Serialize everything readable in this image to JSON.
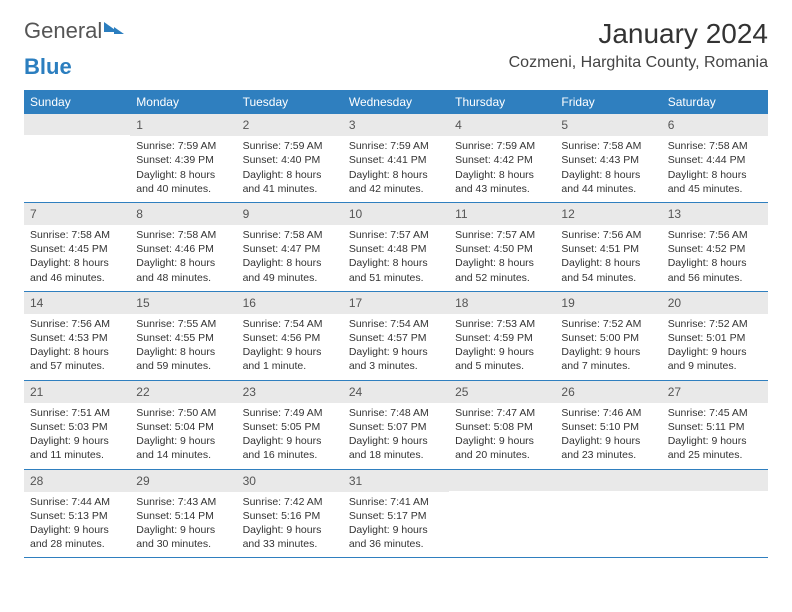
{
  "brand": {
    "part1": "General",
    "part2": "Blue"
  },
  "title": "January 2024",
  "location": "Cozmeni, Harghita County, Romania",
  "weekdays": [
    "Sunday",
    "Monday",
    "Tuesday",
    "Wednesday",
    "Thursday",
    "Friday",
    "Saturday"
  ],
  "weeks": [
    [
      {
        "n": "",
        "sunrise": "",
        "sunset": "",
        "daylight": ""
      },
      {
        "n": "1",
        "sunrise": "Sunrise: 7:59 AM",
        "sunset": "Sunset: 4:39 PM",
        "daylight": "Daylight: 8 hours and 40 minutes."
      },
      {
        "n": "2",
        "sunrise": "Sunrise: 7:59 AM",
        "sunset": "Sunset: 4:40 PM",
        "daylight": "Daylight: 8 hours and 41 minutes."
      },
      {
        "n": "3",
        "sunrise": "Sunrise: 7:59 AM",
        "sunset": "Sunset: 4:41 PM",
        "daylight": "Daylight: 8 hours and 42 minutes."
      },
      {
        "n": "4",
        "sunrise": "Sunrise: 7:59 AM",
        "sunset": "Sunset: 4:42 PM",
        "daylight": "Daylight: 8 hours and 43 minutes."
      },
      {
        "n": "5",
        "sunrise": "Sunrise: 7:58 AM",
        "sunset": "Sunset: 4:43 PM",
        "daylight": "Daylight: 8 hours and 44 minutes."
      },
      {
        "n": "6",
        "sunrise": "Sunrise: 7:58 AM",
        "sunset": "Sunset: 4:44 PM",
        "daylight": "Daylight: 8 hours and 45 minutes."
      }
    ],
    [
      {
        "n": "7",
        "sunrise": "Sunrise: 7:58 AM",
        "sunset": "Sunset: 4:45 PM",
        "daylight": "Daylight: 8 hours and 46 minutes."
      },
      {
        "n": "8",
        "sunrise": "Sunrise: 7:58 AM",
        "sunset": "Sunset: 4:46 PM",
        "daylight": "Daylight: 8 hours and 48 minutes."
      },
      {
        "n": "9",
        "sunrise": "Sunrise: 7:58 AM",
        "sunset": "Sunset: 4:47 PM",
        "daylight": "Daylight: 8 hours and 49 minutes."
      },
      {
        "n": "10",
        "sunrise": "Sunrise: 7:57 AM",
        "sunset": "Sunset: 4:48 PM",
        "daylight": "Daylight: 8 hours and 51 minutes."
      },
      {
        "n": "11",
        "sunrise": "Sunrise: 7:57 AM",
        "sunset": "Sunset: 4:50 PM",
        "daylight": "Daylight: 8 hours and 52 minutes."
      },
      {
        "n": "12",
        "sunrise": "Sunrise: 7:56 AM",
        "sunset": "Sunset: 4:51 PM",
        "daylight": "Daylight: 8 hours and 54 minutes."
      },
      {
        "n": "13",
        "sunrise": "Sunrise: 7:56 AM",
        "sunset": "Sunset: 4:52 PM",
        "daylight": "Daylight: 8 hours and 56 minutes."
      }
    ],
    [
      {
        "n": "14",
        "sunrise": "Sunrise: 7:56 AM",
        "sunset": "Sunset: 4:53 PM",
        "daylight": "Daylight: 8 hours and 57 minutes."
      },
      {
        "n": "15",
        "sunrise": "Sunrise: 7:55 AM",
        "sunset": "Sunset: 4:55 PM",
        "daylight": "Daylight: 8 hours and 59 minutes."
      },
      {
        "n": "16",
        "sunrise": "Sunrise: 7:54 AM",
        "sunset": "Sunset: 4:56 PM",
        "daylight": "Daylight: 9 hours and 1 minute."
      },
      {
        "n": "17",
        "sunrise": "Sunrise: 7:54 AM",
        "sunset": "Sunset: 4:57 PM",
        "daylight": "Daylight: 9 hours and 3 minutes."
      },
      {
        "n": "18",
        "sunrise": "Sunrise: 7:53 AM",
        "sunset": "Sunset: 4:59 PM",
        "daylight": "Daylight: 9 hours and 5 minutes."
      },
      {
        "n": "19",
        "sunrise": "Sunrise: 7:52 AM",
        "sunset": "Sunset: 5:00 PM",
        "daylight": "Daylight: 9 hours and 7 minutes."
      },
      {
        "n": "20",
        "sunrise": "Sunrise: 7:52 AM",
        "sunset": "Sunset: 5:01 PM",
        "daylight": "Daylight: 9 hours and 9 minutes."
      }
    ],
    [
      {
        "n": "21",
        "sunrise": "Sunrise: 7:51 AM",
        "sunset": "Sunset: 5:03 PM",
        "daylight": "Daylight: 9 hours and 11 minutes."
      },
      {
        "n": "22",
        "sunrise": "Sunrise: 7:50 AM",
        "sunset": "Sunset: 5:04 PM",
        "daylight": "Daylight: 9 hours and 14 minutes."
      },
      {
        "n": "23",
        "sunrise": "Sunrise: 7:49 AM",
        "sunset": "Sunset: 5:05 PM",
        "daylight": "Daylight: 9 hours and 16 minutes."
      },
      {
        "n": "24",
        "sunrise": "Sunrise: 7:48 AM",
        "sunset": "Sunset: 5:07 PM",
        "daylight": "Daylight: 9 hours and 18 minutes."
      },
      {
        "n": "25",
        "sunrise": "Sunrise: 7:47 AM",
        "sunset": "Sunset: 5:08 PM",
        "daylight": "Daylight: 9 hours and 20 minutes."
      },
      {
        "n": "26",
        "sunrise": "Sunrise: 7:46 AM",
        "sunset": "Sunset: 5:10 PM",
        "daylight": "Daylight: 9 hours and 23 minutes."
      },
      {
        "n": "27",
        "sunrise": "Sunrise: 7:45 AM",
        "sunset": "Sunset: 5:11 PM",
        "daylight": "Daylight: 9 hours and 25 minutes."
      }
    ],
    [
      {
        "n": "28",
        "sunrise": "Sunrise: 7:44 AM",
        "sunset": "Sunset: 5:13 PM",
        "daylight": "Daylight: 9 hours and 28 minutes."
      },
      {
        "n": "29",
        "sunrise": "Sunrise: 7:43 AM",
        "sunset": "Sunset: 5:14 PM",
        "daylight": "Daylight: 9 hours and 30 minutes."
      },
      {
        "n": "30",
        "sunrise": "Sunrise: 7:42 AM",
        "sunset": "Sunset: 5:16 PM",
        "daylight": "Daylight: 9 hours and 33 minutes."
      },
      {
        "n": "31",
        "sunrise": "Sunrise: 7:41 AM",
        "sunset": "Sunset: 5:17 PM",
        "daylight": "Daylight: 9 hours and 36 minutes."
      },
      {
        "n": "",
        "sunrise": "",
        "sunset": "",
        "daylight": ""
      },
      {
        "n": "",
        "sunrise": "",
        "sunset": "",
        "daylight": ""
      },
      {
        "n": "",
        "sunrise": "",
        "sunset": "",
        "daylight": ""
      }
    ]
  ]
}
